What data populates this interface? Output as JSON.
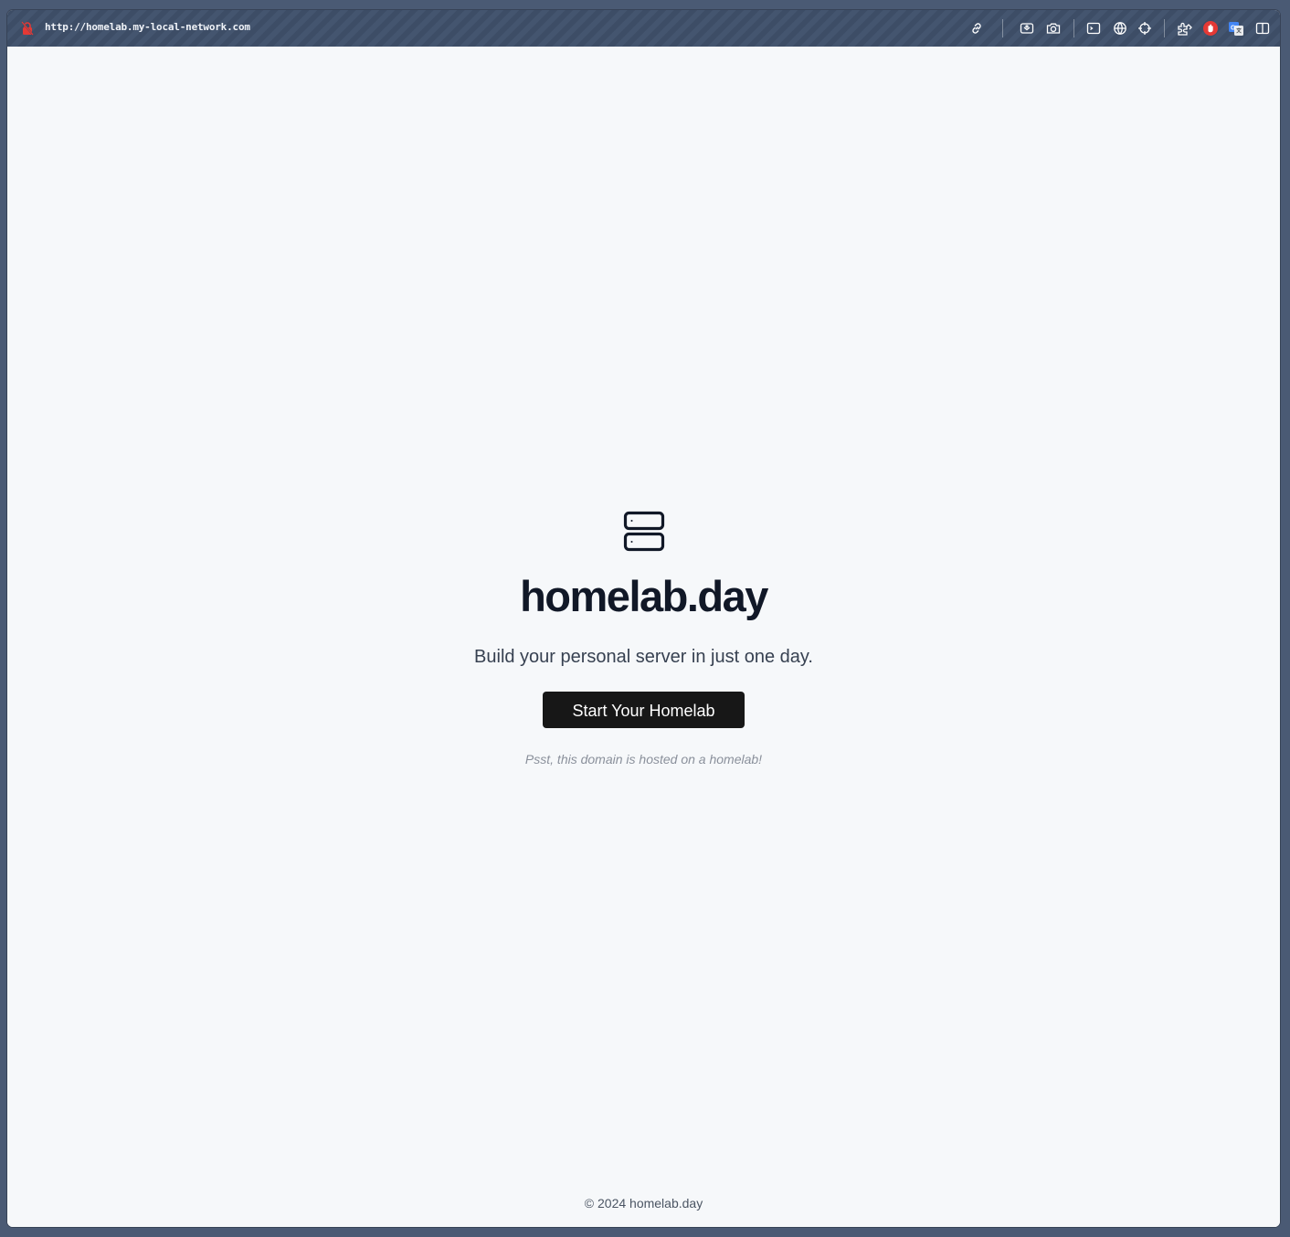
{
  "browser": {
    "url": "http://homelab.my-local-network.com",
    "toolbar_icons": [
      "link-icon",
      "screenshot-icon",
      "camera-icon",
      "terminal-icon",
      "globe-icon",
      "crosshair-icon",
      "extensions-icon",
      "ublock-icon",
      "translate-icon",
      "sidebar-toggle-icon"
    ],
    "accent_red": "#e53935",
    "accent_blue": "#4285f4"
  },
  "hero": {
    "icon": "server-icon",
    "title": "homelab.day",
    "subtitle": "Build your personal server in just one day.",
    "cta_label": "Start Your Homelab",
    "note": "Psst, this domain is hosted on a homelab!"
  },
  "footer": {
    "text": "© 2024 homelab.day"
  },
  "colors": {
    "page_background": "#f6f8fa",
    "button_background": "#171717",
    "title_color": "#111827"
  }
}
